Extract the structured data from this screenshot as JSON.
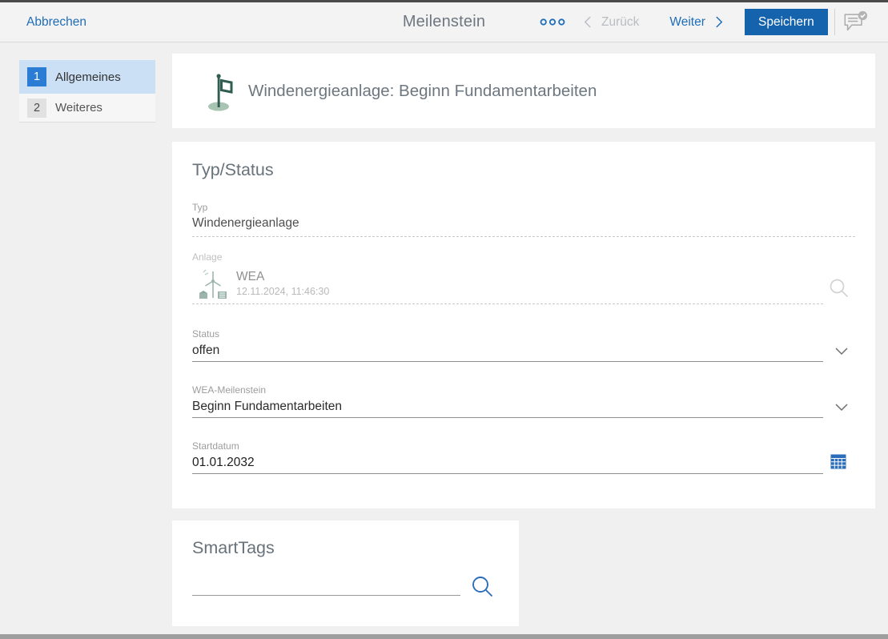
{
  "topbar": {
    "cancel_label": "Abbrechen",
    "title": "Meilenstein",
    "back_label": "Zurück",
    "next_label": "Weiter",
    "save_label": "Speichern"
  },
  "sidebar": {
    "items": [
      {
        "number": "1",
        "label": "Allgemeines",
        "selected": true
      },
      {
        "number": "2",
        "label": "Weiteres",
        "selected": false
      }
    ]
  },
  "record_header": {
    "icon": "milestone-flag",
    "title": "Windenergieanlage: Beginn Fundamentarbeiten"
  },
  "typ_status": {
    "section_title": "Typ/Status",
    "typ": {
      "label": "Typ",
      "value": "Windenergieanlage"
    },
    "anlage": {
      "label": "Anlage",
      "value": "WEA",
      "timestamp": "12.11.2024, 11:46:30",
      "icon": "wind-turbine"
    },
    "status": {
      "label": "Status",
      "value": "offen"
    },
    "wea_meilenstein": {
      "label": "WEA-Meilenstein",
      "value": "Beginn Fundamentarbeiten"
    },
    "startdatum": {
      "label": "Startdatum",
      "value": "01.01.2032"
    }
  },
  "smarttags": {
    "section_title": "SmartTags",
    "value": ""
  },
  "colors": {
    "accent_blue": "#1e6db6",
    "save_button_blue": "#1563ad",
    "selected_item_bg": "#cbdff5",
    "badge_blue": "#2a7cd4",
    "flag_green": "#2f5d50",
    "flag_base_green": "#a9c4b3",
    "disabled_gray": "#b9bdc1"
  }
}
